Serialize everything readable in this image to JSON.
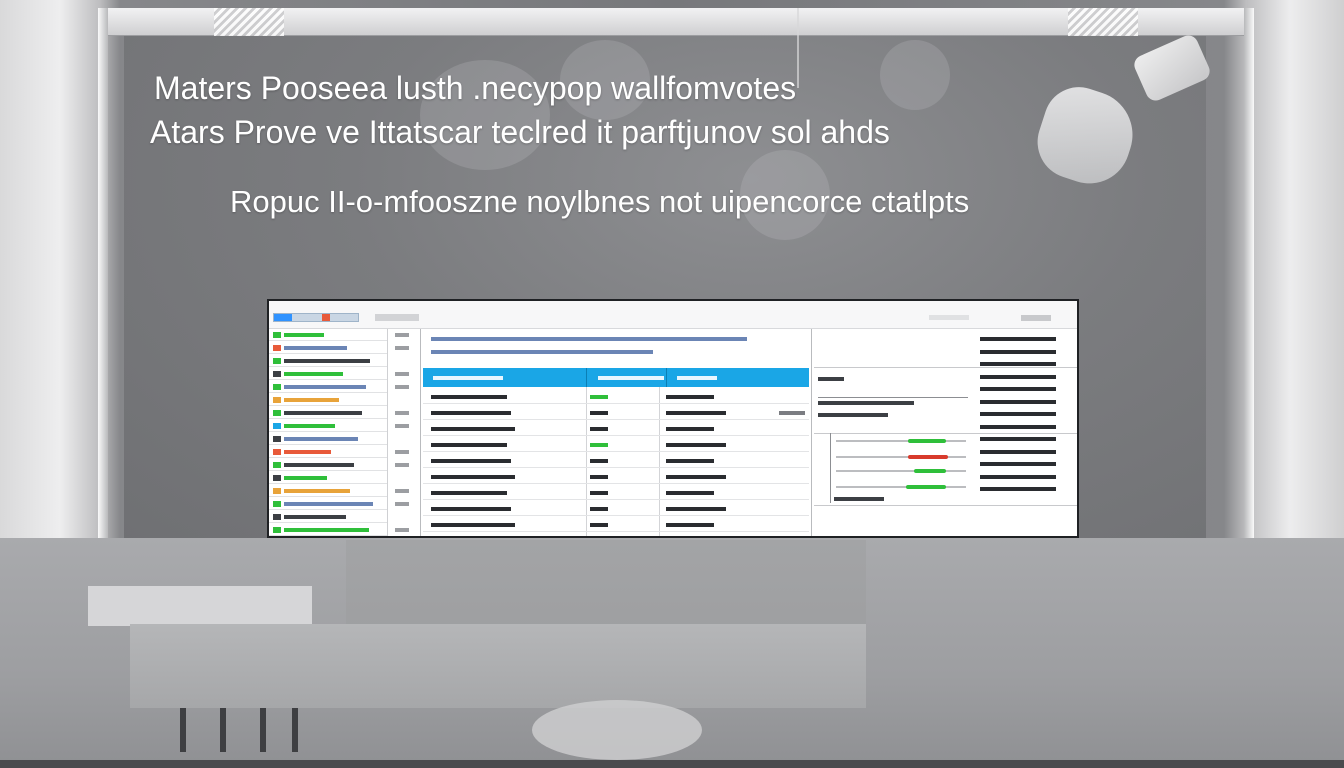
{
  "overlay": {
    "line1": "Maters Pooseea lusth .necypop wallfomvotes",
    "line2": "Atars Prove ve Ittatscar teclred it parftjunov sol ahds",
    "line3": "Ropuc II-o-mfooszne noylbnes not uipencorce ctatlpts"
  },
  "colors": {
    "accent_blue": "#1aa6e6",
    "positive_green": "#2fbf3a",
    "negative_red": "#d83a2c",
    "text_dark": "#2a2c30"
  },
  "icons": {
    "lamp": "pendant-lamp-icon"
  }
}
